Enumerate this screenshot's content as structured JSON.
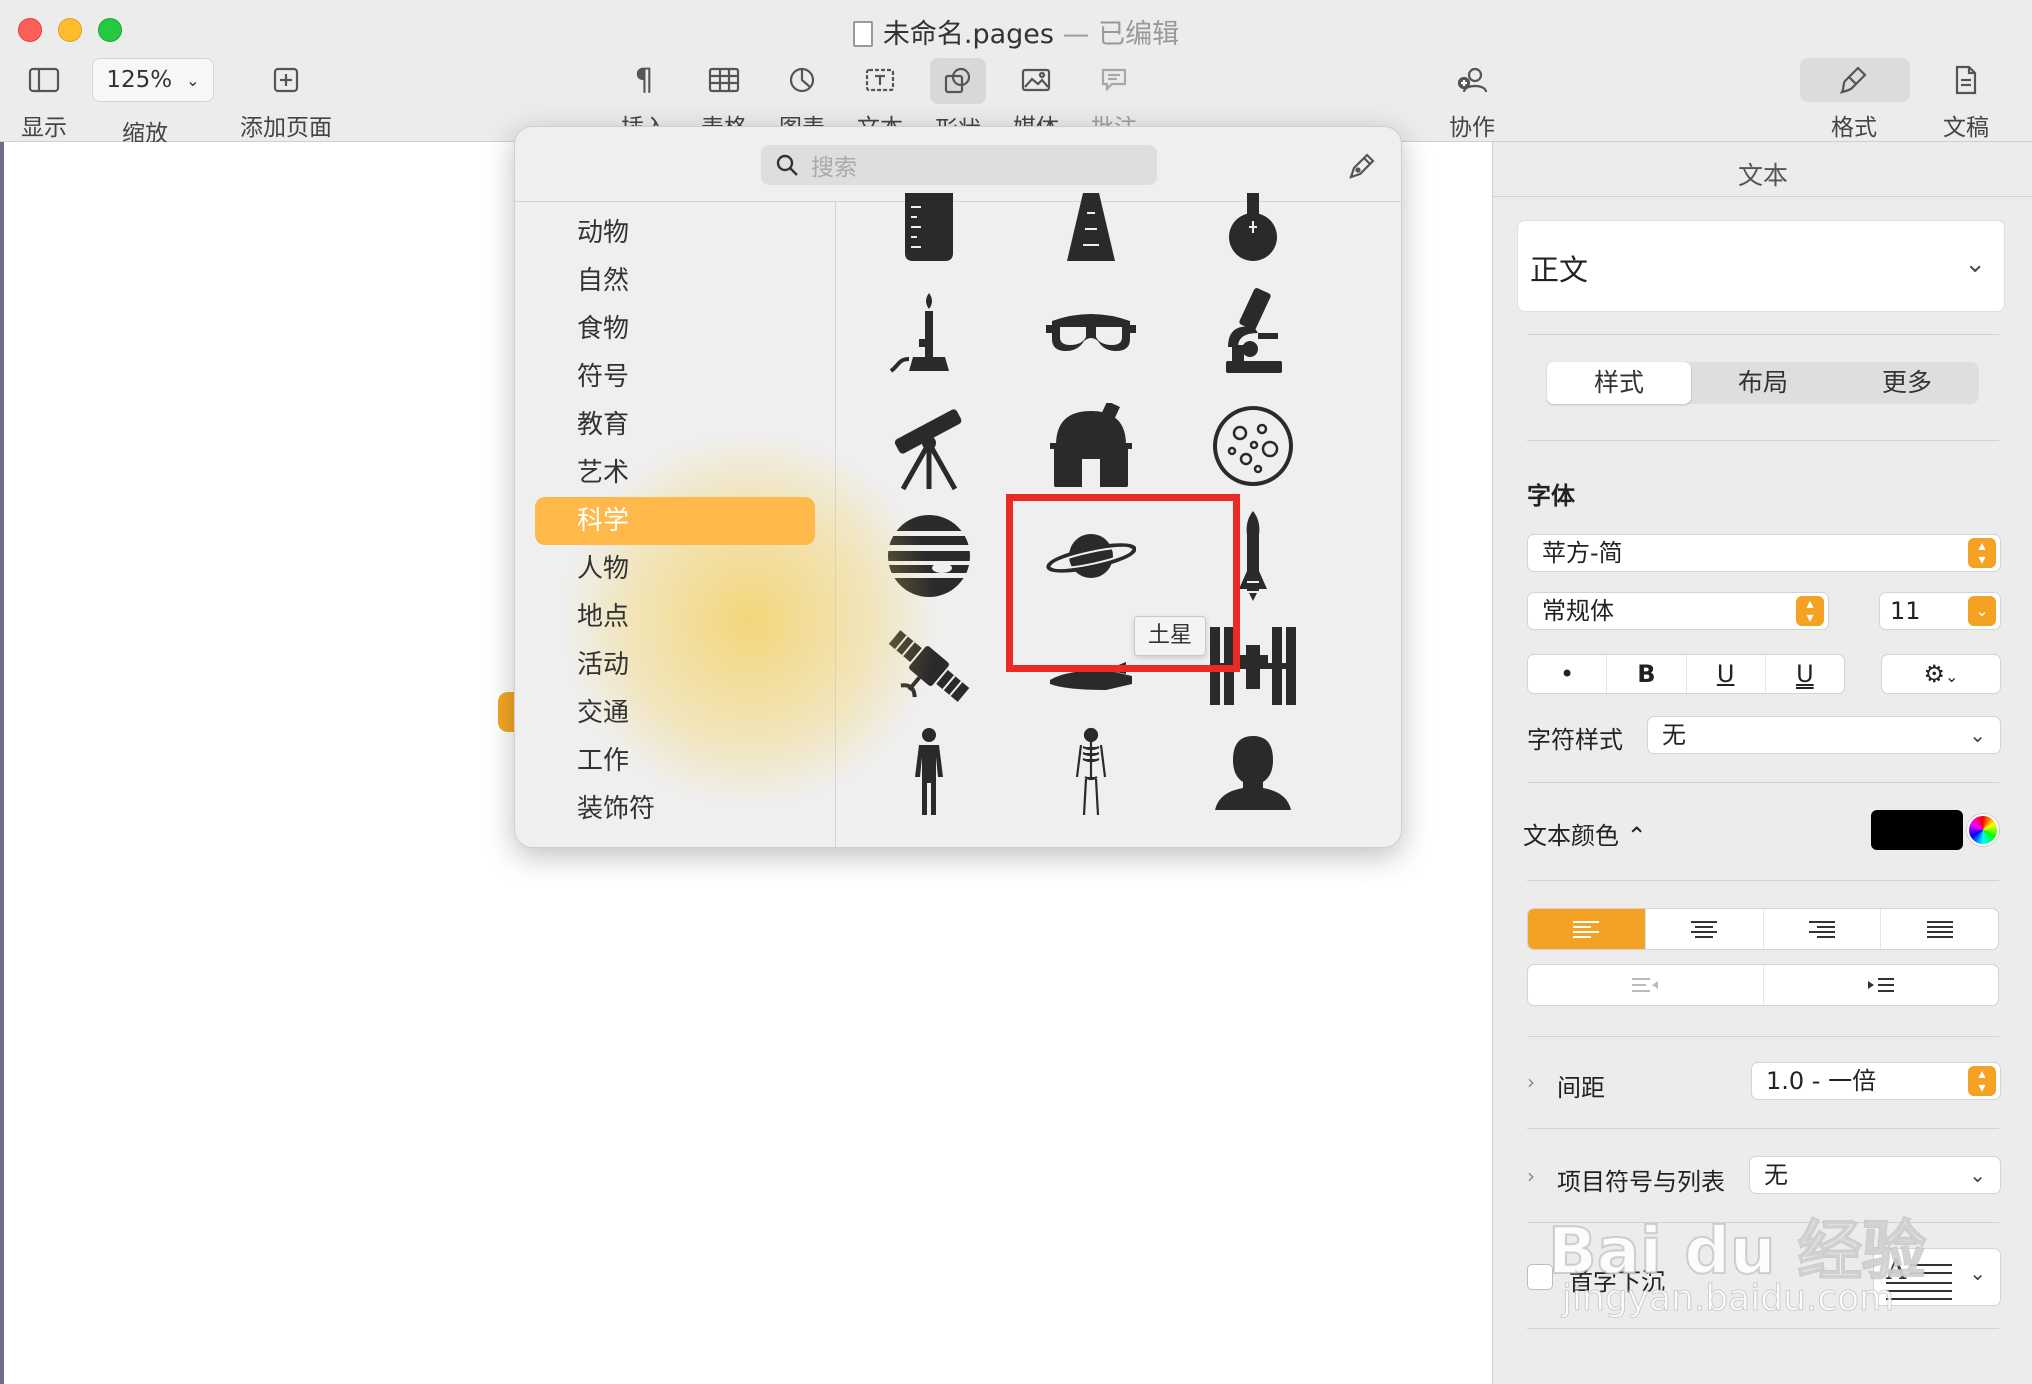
{
  "window": {
    "title": "未命名.pages",
    "separator": "—",
    "status": "已编辑"
  },
  "toolbar": {
    "view_label": "显示",
    "zoom_value": "125%",
    "zoom_label": "缩放",
    "add_page_label": "添加页面",
    "insert_label": "插入",
    "table_label": "表格",
    "chart_label": "图表",
    "text_label": "文本",
    "shape_label": "形状",
    "media_label": "媒体",
    "comment_label": "批注",
    "collaborate_label": "协作",
    "format_label": "格式",
    "document_label": "文稿"
  },
  "shapes_popover": {
    "search_placeholder": "搜索",
    "categories": [
      "动物",
      "自然",
      "食物",
      "符号",
      "教育",
      "艺术",
      "科学",
      "人物",
      "地点",
      "活动",
      "交通",
      "工作",
      "装饰符"
    ],
    "selected_category": "科学",
    "hovered_shape_tooltip": "土星"
  },
  "inspector": {
    "title": "文本",
    "paragraph_style": "正文",
    "tabs": [
      "样式",
      "布局",
      "更多"
    ],
    "active_tab": "样式",
    "font_section": "字体",
    "font_family": "苹方-简",
    "font_weight": "常规体",
    "font_size": "11",
    "bold_label": "B",
    "underline_label": "U",
    "underline2_label": "U",
    "dot_label": "•",
    "char_style_label": "字符样式",
    "char_style_value": "无",
    "text_color_label": "文本颜色 ⌃",
    "spacing_label": "间距",
    "spacing_value": "1.0 - 一倍",
    "bullets_label": "项目符号与列表",
    "bullets_value": "无",
    "dropcap_label": "首字下沉"
  },
  "colors": {
    "accent": "#f4a223",
    "selected_category_bg": "#ffb84a",
    "highlight_box": "#ec2a24"
  },
  "watermark": {
    "brand": "Bai du 经验",
    "url": "jingyan.baidu.com"
  }
}
